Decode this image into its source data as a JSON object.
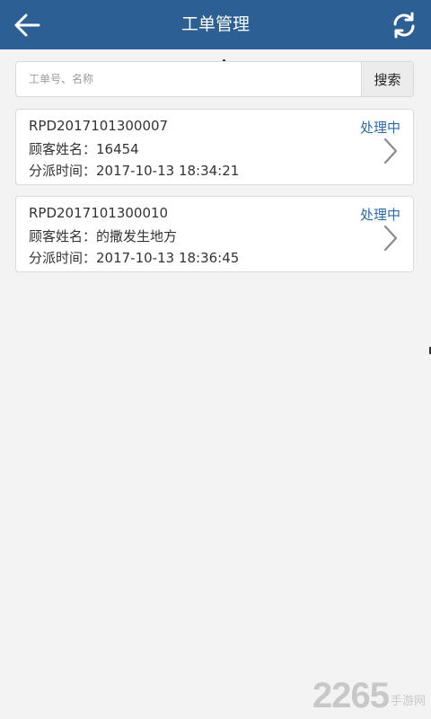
{
  "header": {
    "title": "工单管理",
    "back_icon": "arrow-left-icon",
    "refresh_icon": "refresh-icon"
  },
  "search": {
    "placeholder": "工单号、名称",
    "button_label": "搜索"
  },
  "orders": [
    {
      "id": "RPD2017101300007",
      "customer_line": "顾客姓名：16454",
      "dispatch_line": "分派时间：2017-10-13 18:34:21",
      "status": "处理中"
    },
    {
      "id": "RPD2017101300010",
      "customer_line": "顾客姓名：的撒发生地方",
      "dispatch_line": "分派时间：2017-10-13 18:36:45",
      "status": "处理中"
    }
  ],
  "watermark": {
    "number": "2265",
    "site": "手游网"
  },
  "colors": {
    "header_bg": "#2c5f94",
    "status": "#2c6aa8",
    "background": "#f3f3f3"
  }
}
